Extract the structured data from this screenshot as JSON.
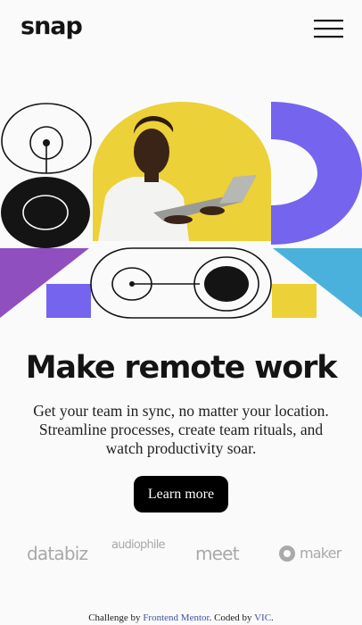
{
  "header": {
    "logo": "snap"
  },
  "hero": {
    "headline": "Make remote work",
    "subtext": "Get your team in sync, no matter your location. Streamline processes, create team rituals, and watch productivity soar.",
    "cta_label": "Learn more"
  },
  "clients": [
    {
      "name": "databiz"
    },
    {
      "name": "audiophile"
    },
    {
      "name": "meet"
    },
    {
      "name": "maker"
    }
  ],
  "footer": {
    "prefix": "Challenge by ",
    "link1": "Frontend Mentor",
    "middle": ". Coded by ",
    "link2": "VIC",
    "suffix": "."
  },
  "colors": {
    "yellow": "#ecd138",
    "purple": "#7564ee",
    "violet": "#8f4fbf",
    "blue": "#4ab1dd",
    "black": "#141414"
  }
}
